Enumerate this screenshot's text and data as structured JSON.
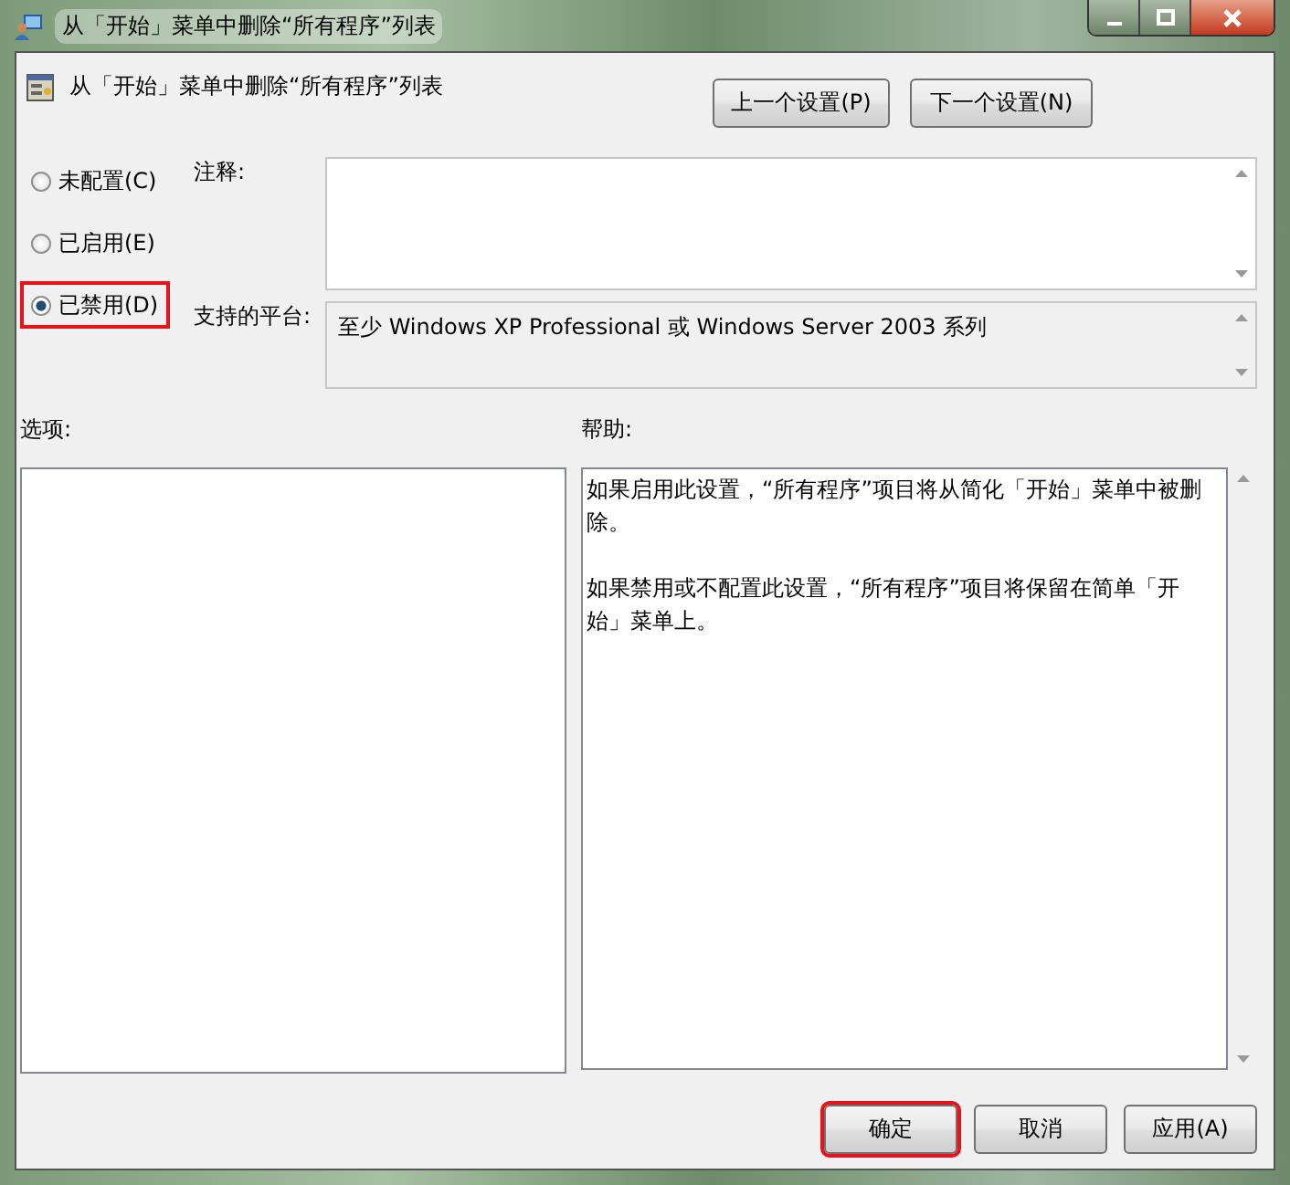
{
  "window": {
    "title": "从「开始」菜单中删除“所有程序”列表"
  },
  "header": {
    "title": "从「开始」菜单中删除“所有程序”列表"
  },
  "nav_buttons": [
    {
      "label": "上一个设置(P)"
    },
    {
      "label": "下一个设置(N)"
    }
  ],
  "states": [
    {
      "label": "未配置(C)",
      "selected": false,
      "highlighted": false
    },
    {
      "label": "已启用(E)",
      "selected": false,
      "highlighted": false
    },
    {
      "label": "已禁用(D)",
      "selected": true,
      "highlighted": true
    }
  ],
  "comment": {
    "label": "注释:"
  },
  "platform": {
    "label": "支持的平台:",
    "value": "至少 Windows XP Professional 或 Windows Server 2003 系列"
  },
  "options": {
    "label": "选项:"
  },
  "help": {
    "label": "帮助:",
    "paragraphs": [
      "如果启用此设置，“所有程序”项目将从简化「开始」菜单中被删除。",
      "如果禁用或不配置此设置，“所有程序”项目将保留在简单「开始」菜单上。"
    ]
  },
  "buttons": [
    {
      "label": "确定",
      "highlighted": true
    },
    {
      "label": "取消",
      "highlighted": false
    },
    {
      "label": "应用(A)",
      "highlighted": false
    }
  ]
}
